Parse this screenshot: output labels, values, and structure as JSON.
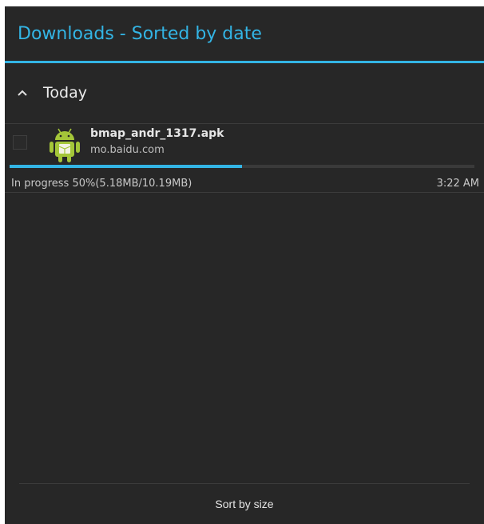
{
  "header": {
    "title": "Downloads - Sorted by date"
  },
  "group": {
    "label": "Today",
    "icon": "chevron-up-icon"
  },
  "downloads": [
    {
      "icon": "android-app-icon",
      "file_name": "bmap_andr_1317.apk",
      "source": "mo.baidu.com",
      "progress_fraction": 0.5,
      "status": "In progress 50%(5.18MB/10.19MB)",
      "time": "3:22 AM"
    }
  ],
  "footer": {
    "sort_label": "Sort by size"
  },
  "colors": {
    "accent": "#33b5e5",
    "background": "#272727",
    "android_green": "#a4c639"
  }
}
